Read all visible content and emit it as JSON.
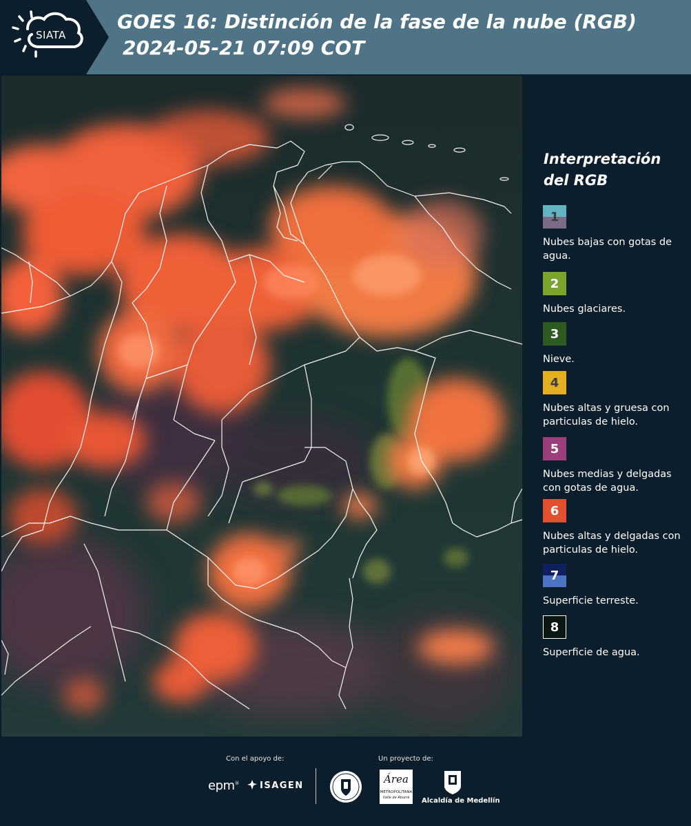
{
  "header": {
    "logo_text": "SIATA",
    "title": "GOES 16: Distinción de la fase de la nube (RGB)",
    "subtitle": "2024-05-21 07:09 COT",
    "colors": {
      "header_bg": "#4f7485",
      "page_bg": "#0c1e2c"
    }
  },
  "map": {
    "imagery_icon": "satellite-rgb-composite",
    "colors": {
      "ice_cloud": "#ff5a34",
      "land": "#1f3b37",
      "border": "#ffffff"
    }
  },
  "legend": {
    "title": "Interpretación del RGB",
    "items": [
      {
        "number": "1",
        "label": "Nubes bajas con gotas de agua.",
        "color_top": "#62b4c2",
        "color_bottom": "#7c6b86",
        "number_color": "#3c3c3c"
      },
      {
        "number": "2",
        "label": "Nubes glaciares.",
        "color": "#7aa42e",
        "number_color": "#ffffff"
      },
      {
        "number": "3",
        "label": "Nieve.",
        "color": "#2e5a22",
        "number_color": "#ffffff"
      },
      {
        "number": "4",
        "label": "Nubes altas y gruesa con particulas de hielo.",
        "color": "#e4b023",
        "number_color": "#3c3c3c"
      },
      {
        "number": "5",
        "label": "Nubes medias y delgadas con gotas de agua.",
        "color": "#9b3f7a",
        "number_color": "#ffffff"
      },
      {
        "number": "6",
        "label": "Nubes altas y delgadas con particulas de hielo.",
        "color": "#e3502f",
        "number_color": "#ffffff"
      },
      {
        "number": "7",
        "label": "Superficie terreste.",
        "color_top": "#0f1f5f",
        "color_bottom": "#4d74c2",
        "number_color": "#ffffff"
      },
      {
        "number": "8",
        "label": "Superficie de agua.",
        "color": "#081810",
        "number_color": "#ffffff",
        "border": "#ffffff"
      }
    ]
  },
  "footer": {
    "support_label": "Con el apoyo de:",
    "project_label": "Un proyecto de:",
    "epm": "epm",
    "epm_reg": "®",
    "isagen": "ISAGEN",
    "area_word": "Área",
    "area_sub1": "METROPOLITANA",
    "area_sub2": "Valle de Aburrá",
    "alcaldia": "Alcaldía de Medellín"
  }
}
